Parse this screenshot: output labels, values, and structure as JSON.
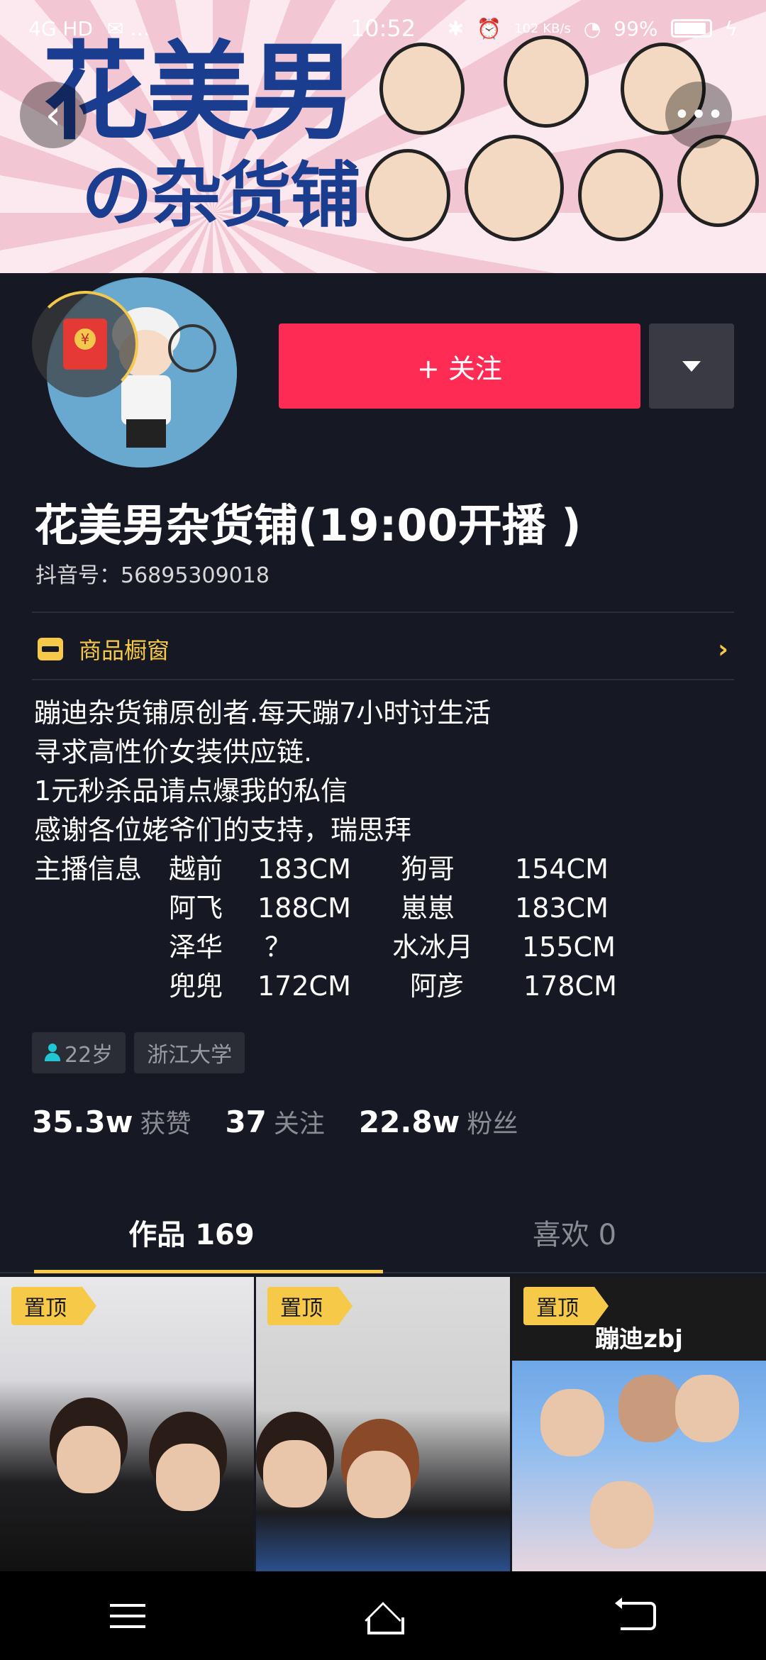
{
  "status_bar": {
    "network": "4G HD",
    "time": "10:52",
    "speed": "102 KB/s",
    "battery": "99%"
  },
  "banner": {
    "title": "花美男",
    "subtitle": "の杂货铺"
  },
  "profile": {
    "follow_label": "+ 关注",
    "nickname": "花美男杂货铺(19:00开播 )",
    "douyin_id": "抖音号：56895309018"
  },
  "shop": {
    "label": "商品橱窗"
  },
  "bio": {
    "lines": [
      "蹦迪杂货铺原创者.每天蹦7小时讨生活",
      "寻求高性价女装供应链.",
      "1元秒杀品请点爆我的私信",
      "感谢各位姥爷们的支持，瑞思拜"
    ],
    "anchor_label": "主播信息",
    "anchors": [
      {
        "name1": "越前",
        "h1": "183CM",
        "name2": "狗哥",
        "h2": "154CM"
      },
      {
        "name1": "阿飞",
        "h1": "188CM",
        "name2": "崽崽",
        "h2": "183CM"
      },
      {
        "name1": "泽华",
        "h1": "？",
        "name2": "水冰月",
        "h2": "155CM"
      },
      {
        "name1": "兜兜",
        "h1": "172CM",
        "name2": "阿彦",
        "h2": "178CM"
      }
    ]
  },
  "tags": {
    "age": "22岁",
    "school": "浙江大学"
  },
  "stats": {
    "likes_num": "35.3w",
    "likes_label": "获赞",
    "following_num": "37",
    "following_label": "关注",
    "fans_num": "22.8w",
    "fans_label": "粉丝"
  },
  "tabs": {
    "works": "作品 169",
    "likes": "喜欢 0"
  },
  "videos": [
    {
      "pin": "置顶"
    },
    {
      "pin": "置顶"
    },
    {
      "pin": "置顶",
      "title": "蹦迪zbj"
    }
  ],
  "colors": {
    "background": "#161823",
    "accent_red": "#fe2c55",
    "accent_yellow": "#f7c948"
  }
}
